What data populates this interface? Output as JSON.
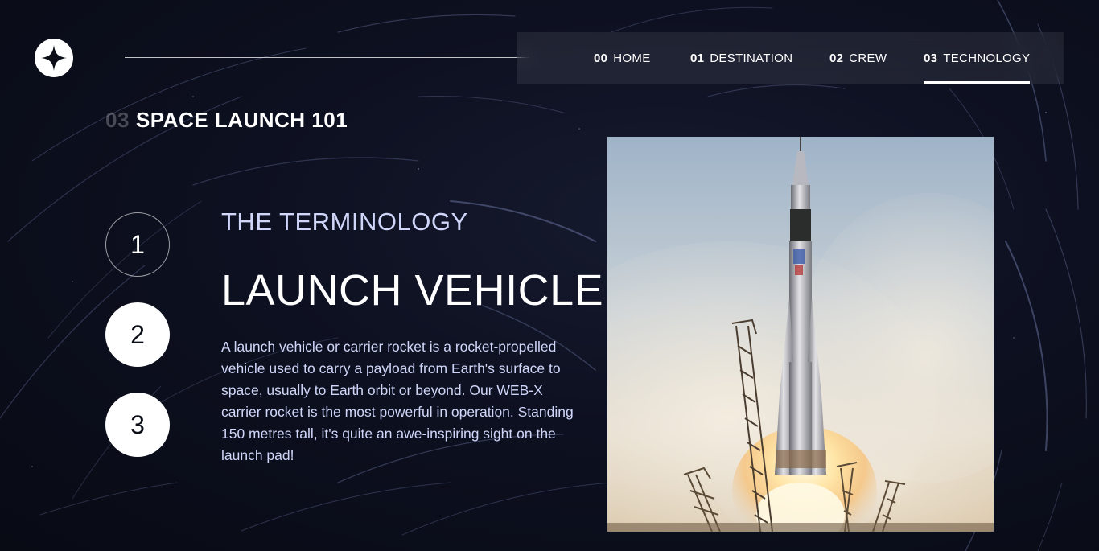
{
  "logo": {
    "icon": "star-logo-icon"
  },
  "nav": {
    "items": [
      {
        "num": "00",
        "label": "HOME"
      },
      {
        "num": "01",
        "label": "DESTINATION"
      },
      {
        "num": "02",
        "label": "CREW"
      },
      {
        "num": "03",
        "label": "TECHNOLOGY",
        "active": true
      }
    ]
  },
  "section": {
    "num": "03",
    "title": "SPACE LAUNCH 101"
  },
  "steps": [
    "1",
    "2",
    "3"
  ],
  "content": {
    "eyebrow": "THE TERMINOLOGY",
    "headline": "LAUNCH VEHICLE",
    "body": "A launch vehicle or carrier rocket is a rocket-propelled vehicle used to carry a payload from Earth's surface to space, usually to Earth orbit or beyond. Our WEB-X carrier rocket is the most powerful in operation. Standing 150 metres tall, it's quite an awe-inspiring sight on the launch pad!"
  },
  "colors": {
    "background": "#0b0d17",
    "accent_text": "#d0d6f9",
    "white": "#ffffff"
  }
}
